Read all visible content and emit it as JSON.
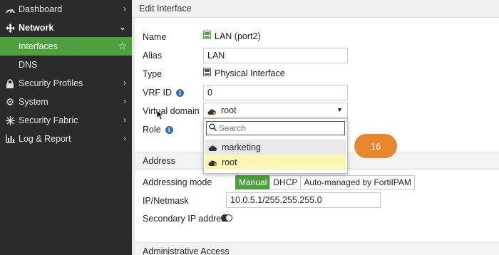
{
  "sidebar": {
    "items": [
      {
        "label": "Dashboard",
        "icon": "dashboard-icon"
      },
      {
        "label": "Network",
        "icon": "network-icon"
      },
      {
        "label": "Interfaces"
      },
      {
        "label": "DNS"
      },
      {
        "label": "Security Profiles",
        "icon": "lock-icon"
      },
      {
        "label": "System",
        "icon": "gear-icon"
      },
      {
        "label": "Security Fabric",
        "icon": "fabric-icon"
      },
      {
        "label": "Log & Report",
        "icon": "chart-icon"
      }
    ]
  },
  "header": {
    "title": "Edit Interface"
  },
  "form": {
    "name_label": "Name",
    "name_value": "LAN (port2)",
    "alias_label": "Alias",
    "alias_value": "LAN",
    "type_label": "Type",
    "type_value": "Physical Interface",
    "vrf_label": "VRF ID",
    "vrf_value": "0",
    "vdom_label": "Virtual domain",
    "vdom_value": "root",
    "role_label": "Role"
  },
  "dropdown": {
    "search_placeholder": "Search",
    "options": [
      "marketing",
      "root"
    ]
  },
  "badge": {
    "text": "16"
  },
  "address": {
    "section_title": "Address",
    "mode_label": "Addressing mode",
    "modes": [
      "Manual",
      "DHCP",
      "Auto-managed by FortiIPAM"
    ],
    "ip_label": "IP/Netmask",
    "ip_value": "10.0.5.1/255.255.255.0",
    "secondary_label": "Secondary IP address"
  },
  "admin": {
    "section_title": "Administrative Access"
  },
  "colors": {
    "accent": "#4e9f3d",
    "sidebar": "#2b2b2b",
    "badge": "#e8872d",
    "selected": "#fbf6b3"
  }
}
